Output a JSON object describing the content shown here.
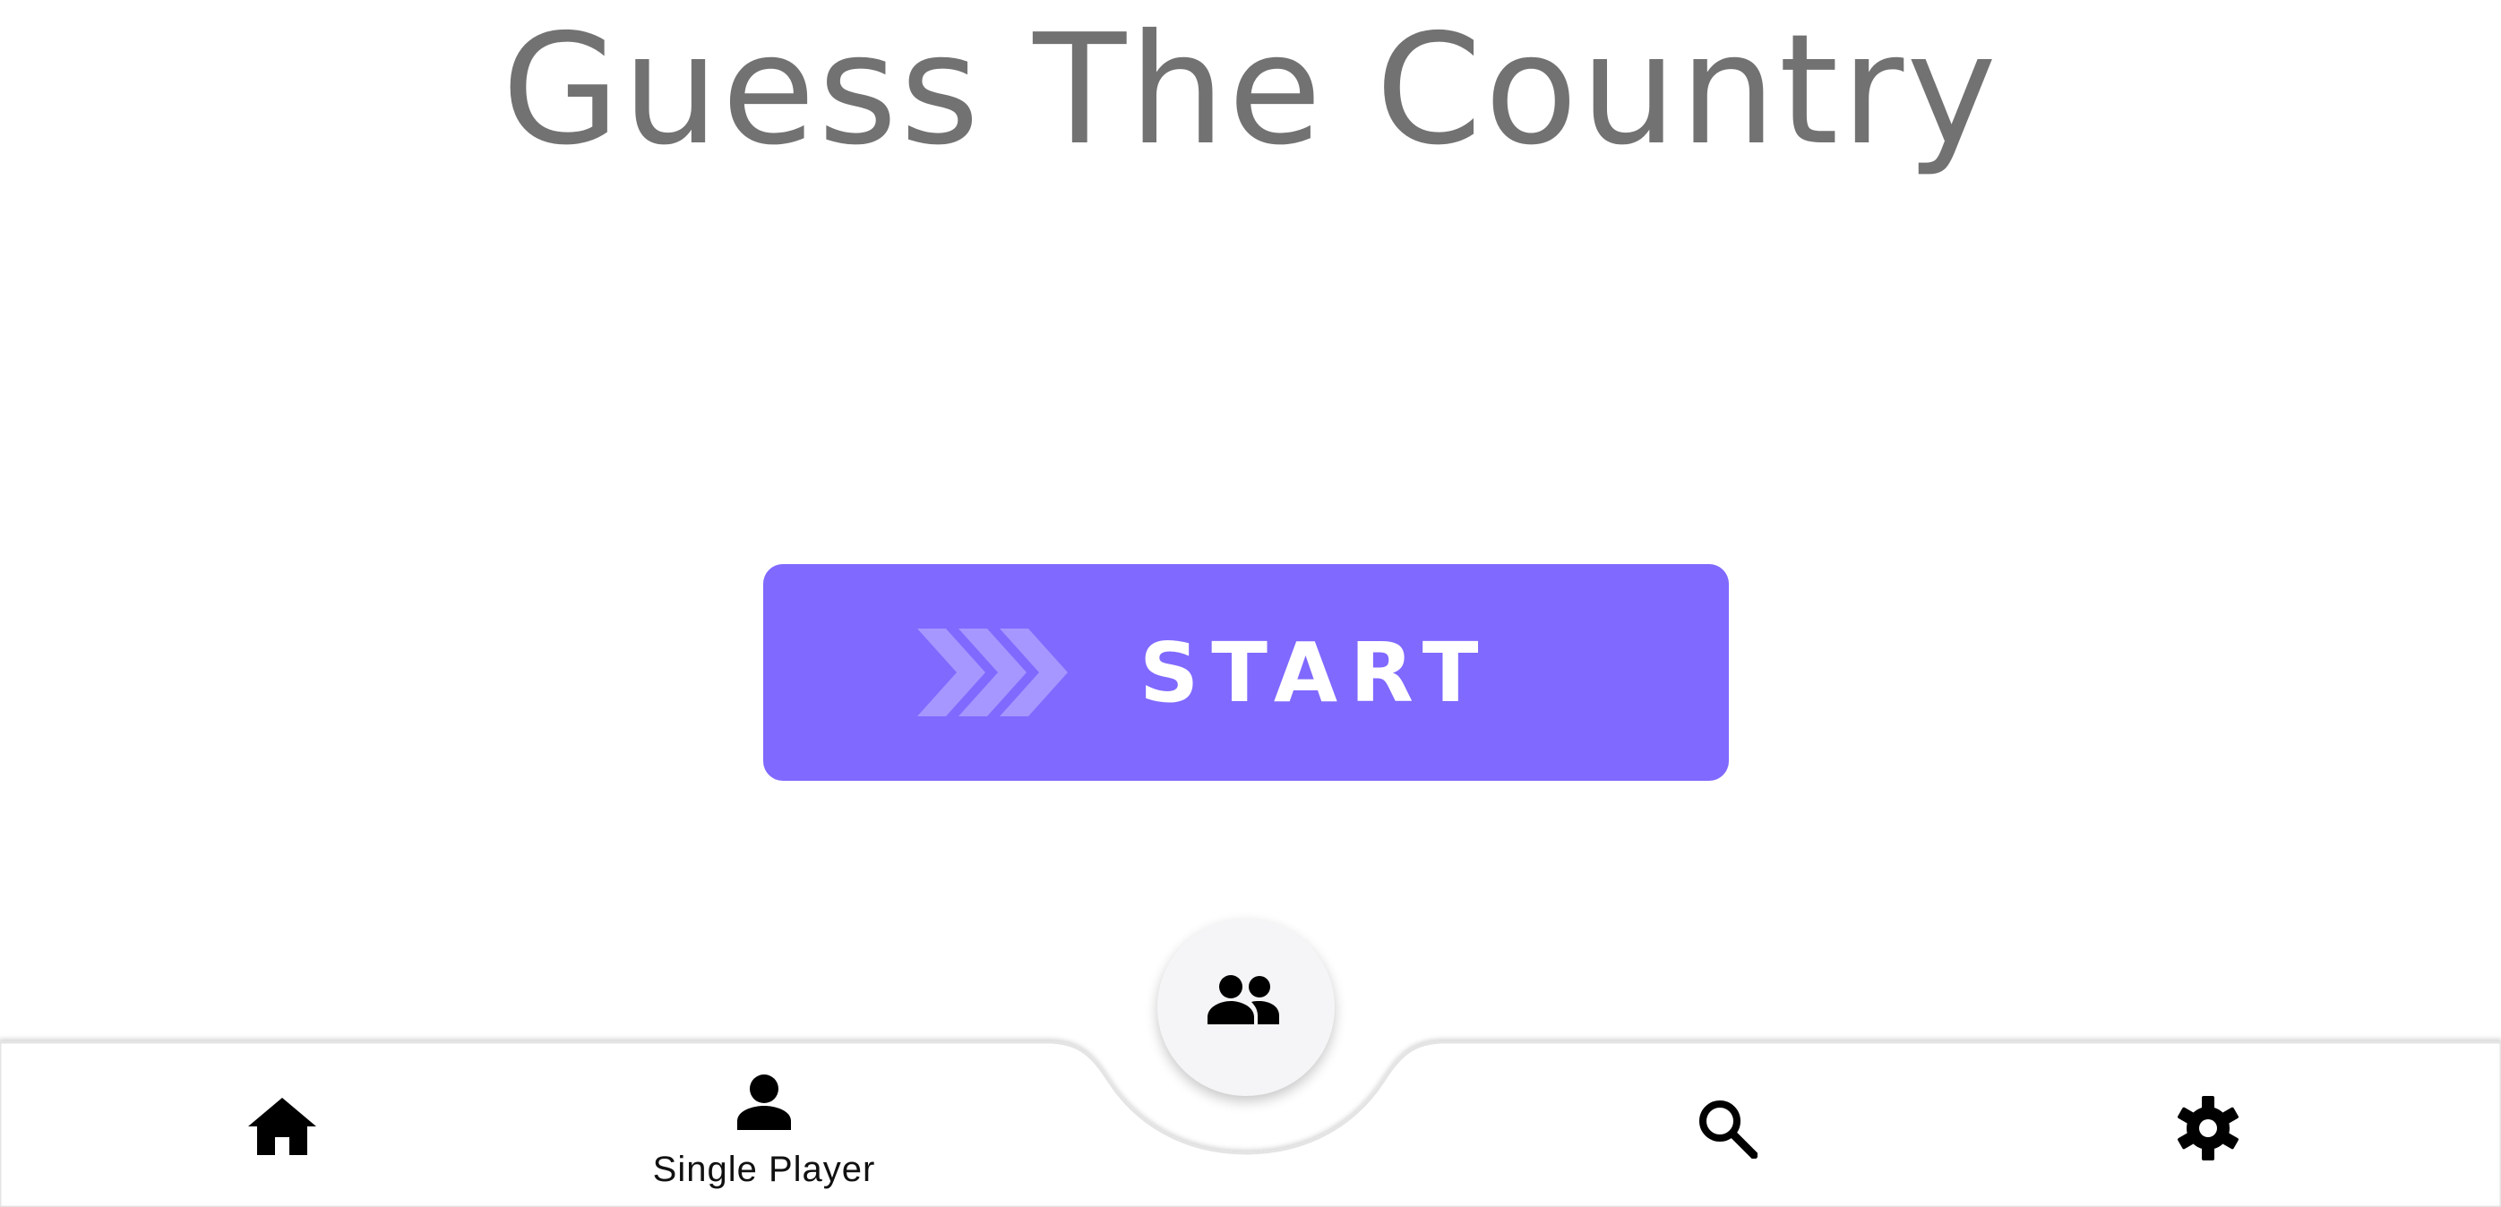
{
  "title": "Guess The Country",
  "start_button": {
    "label": "START",
    "icon": "triple-chevron-right-icon"
  },
  "bottom_nav": {
    "items": [
      {
        "id": "home",
        "icon": "home-icon",
        "label": ""
      },
      {
        "id": "single-player",
        "icon": "person-icon",
        "label": "Single Player"
      },
      {
        "id": "search",
        "icon": "search-icon",
        "label": ""
      },
      {
        "id": "settings",
        "icon": "gear-icon",
        "label": ""
      }
    ],
    "center_fab": {
      "icon": "people-icon"
    }
  },
  "colors": {
    "accent": "#7f69ff",
    "chevron": "#a597ff",
    "title_text": "#727272",
    "fab_background": "#f5f5f7",
    "nav_icon": "#000000"
  }
}
